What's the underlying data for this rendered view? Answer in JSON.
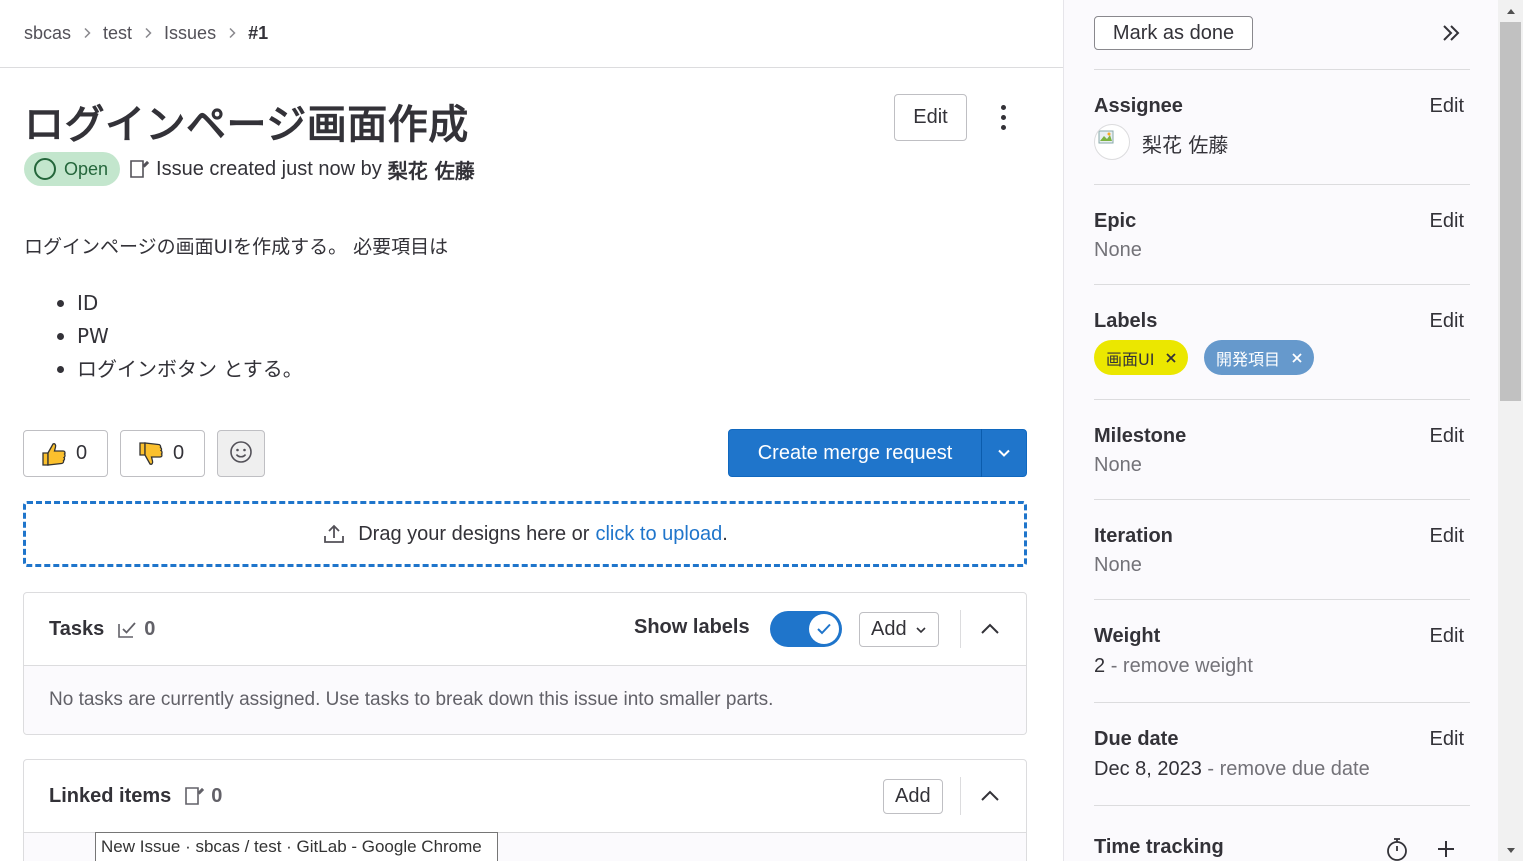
{
  "breadcrumb": [
    "sbcas",
    "test",
    "Issues",
    "#1"
  ],
  "issue": {
    "title": "ログインページ画面作成",
    "edit_label": "Edit",
    "status": "Open",
    "created_text": "Issue created just now by",
    "author": "梨花 佐藤"
  },
  "description": {
    "text": "ログインページの画面UIを作成する。 必要項目は",
    "items": [
      "ID",
      "PW",
      "ログインボタン とする。"
    ]
  },
  "awards": {
    "thumbs_up_count": "0",
    "thumbs_down_count": "0"
  },
  "merge_request": {
    "label": "Create merge request"
  },
  "upload": {
    "text": "Drag your designs here or",
    "link": "click to upload",
    "suffix": "."
  },
  "tasks": {
    "title": "Tasks",
    "count": "0",
    "show_labels": "Show labels",
    "show_labels_on": true,
    "add_label": "Add",
    "empty_text": "No tasks are currently assigned. Use tasks to break down this issue into smaller parts."
  },
  "linked": {
    "title": "Linked items",
    "count": "0",
    "add_label": "Add"
  },
  "tooltip": "New Issue · sbcas / test · GitLab - Google Chrome",
  "sidebar": {
    "mark_done": "Mark as done",
    "edit_label": "Edit",
    "assignee": {
      "label": "Assignee",
      "name": "梨花 佐藤"
    },
    "epic": {
      "label": "Epic",
      "value": "None"
    },
    "labels": {
      "label": "Labels",
      "items": [
        {
          "name": "画面UI",
          "color": "#ebe700",
          "text_color": "#333238"
        },
        {
          "name": "開発項目",
          "color": "#6699cc",
          "text_color": "#ffffff"
        }
      ]
    },
    "milestone": {
      "label": "Milestone",
      "value": "None"
    },
    "iteration": {
      "label": "Iteration",
      "value": "None"
    },
    "weight": {
      "label": "Weight",
      "value": "2",
      "remove": "- remove weight"
    },
    "due_date": {
      "label": "Due date",
      "value": "Dec 8, 2023",
      "remove": "- remove due date"
    },
    "time_tracking": {
      "label": "Time tracking"
    }
  },
  "colors": {
    "primary": "#1f75cb",
    "open_bg": "#c3e6cd",
    "open_fg": "#24663b"
  }
}
